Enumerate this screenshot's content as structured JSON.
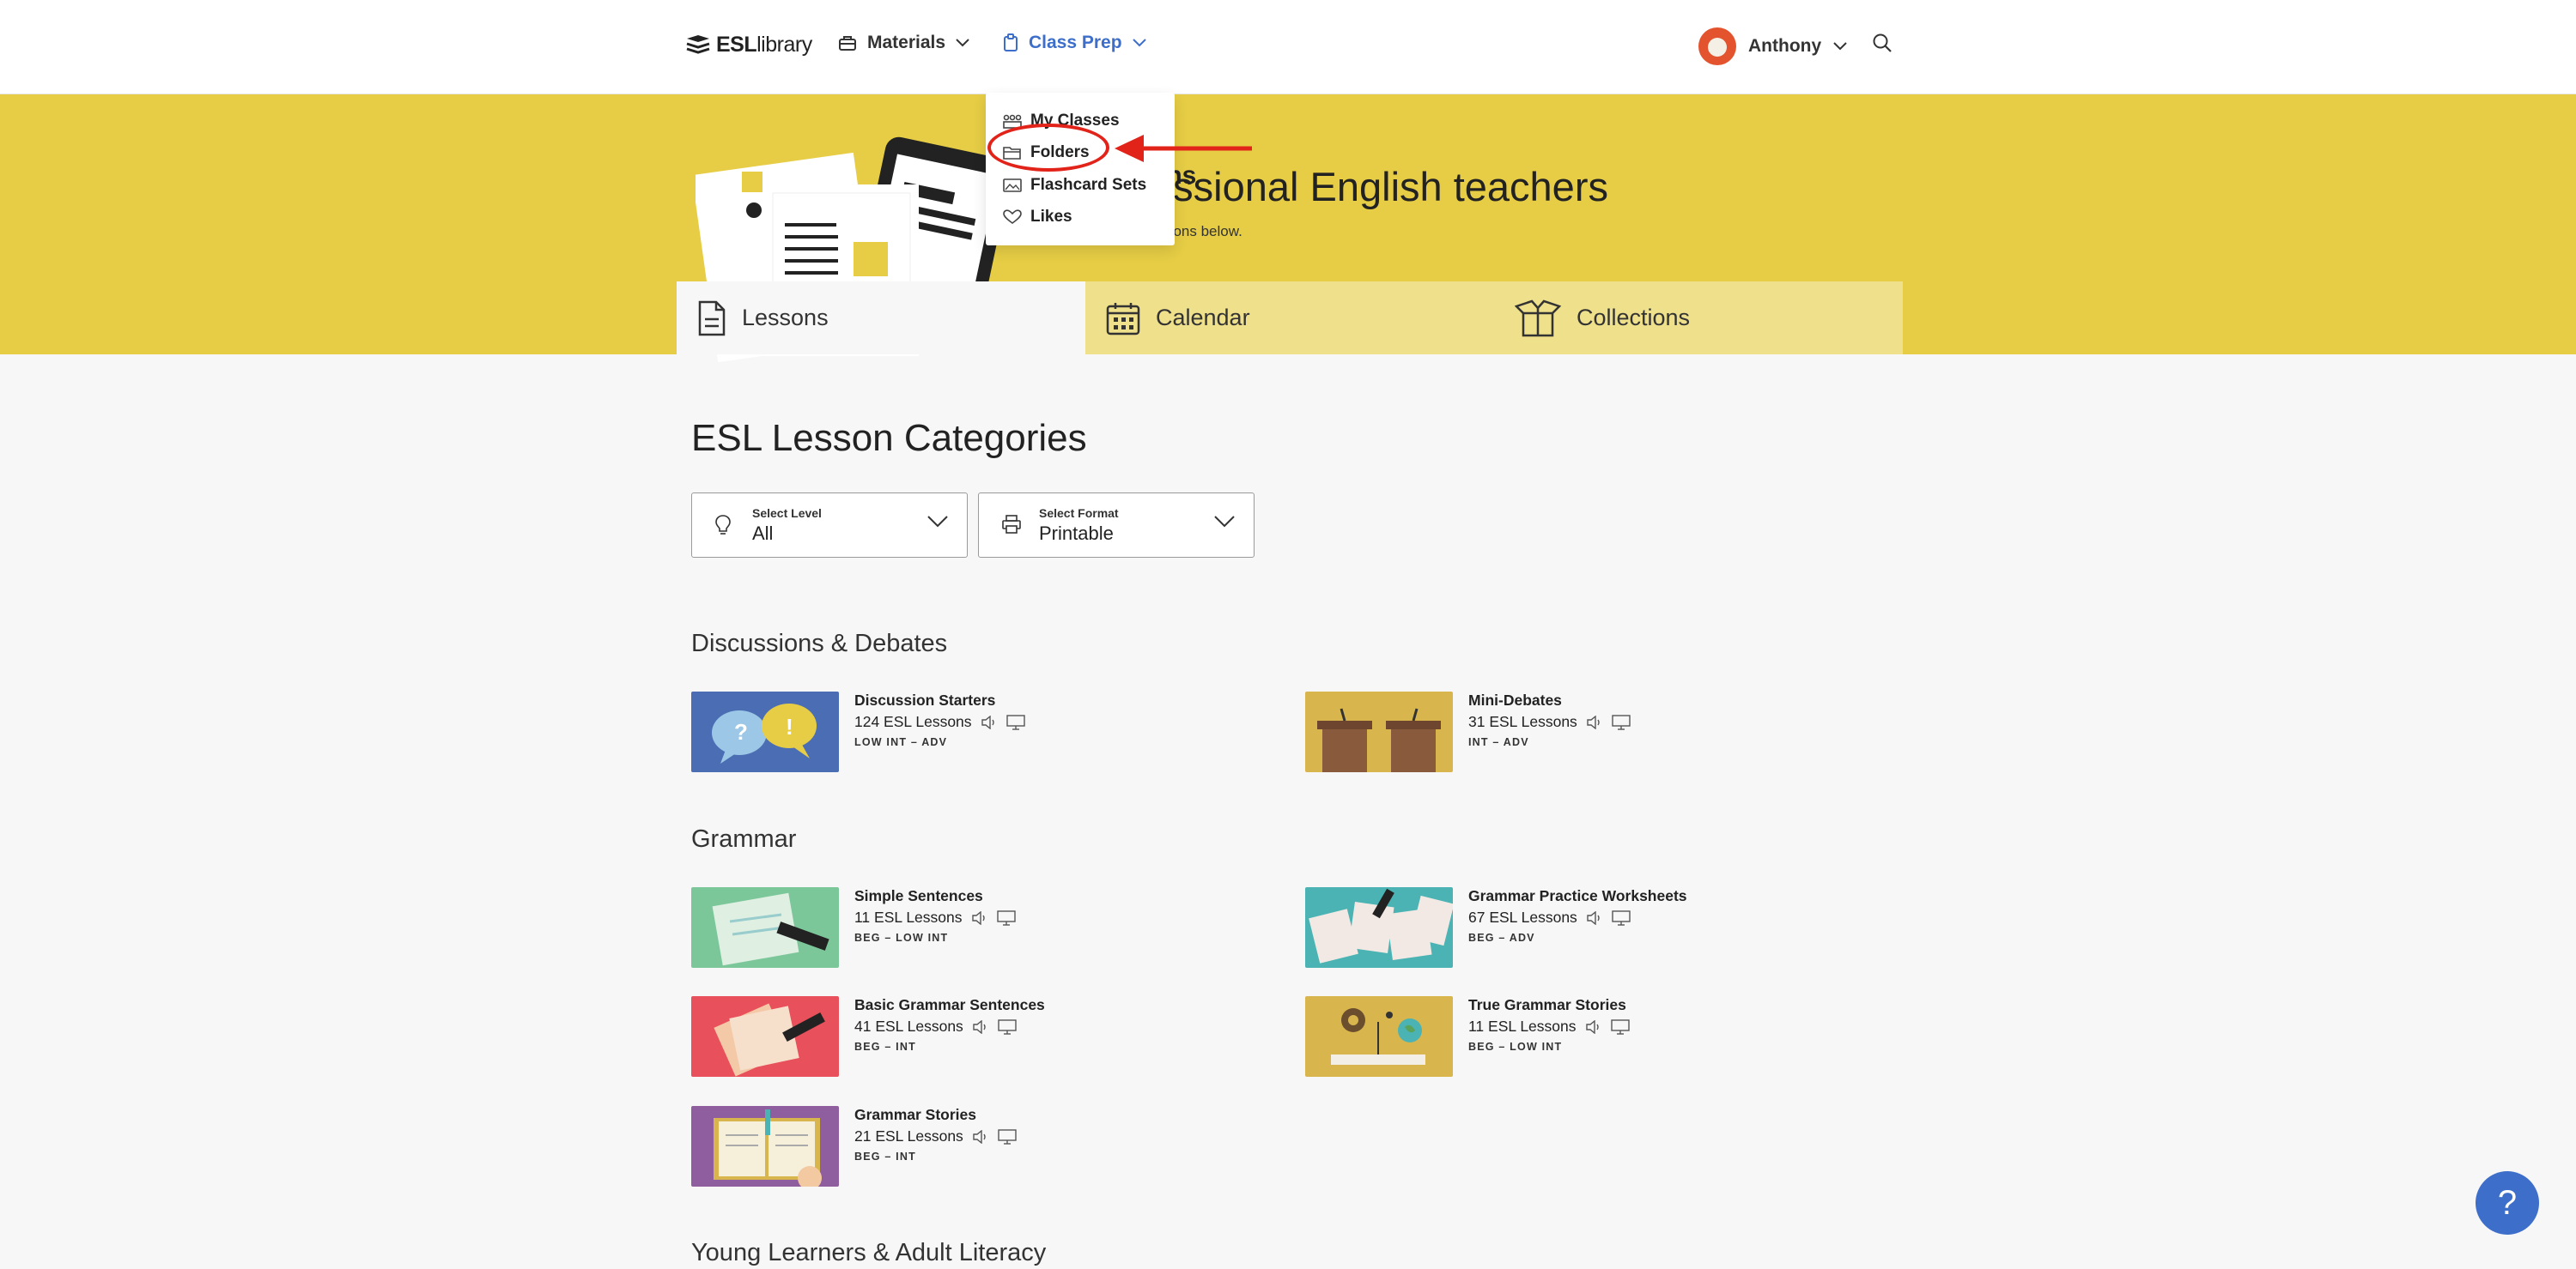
{
  "nav": {
    "logo_bold": "ESL",
    "logo_rest": "library",
    "materials_label": "Materials",
    "classprep_label": "Class Prep",
    "user_name": "Anthony",
    "accent_color": "#3d6ec9"
  },
  "dropdown": {
    "items": [
      {
        "label": "My Classes",
        "icon": "classes-icon"
      },
      {
        "label": "Folders",
        "icon": "folder-icon"
      },
      {
        "label": "Flashcard Sets",
        "icon": "flashcard-icon"
      },
      {
        "label": "Likes",
        "icon": "heart-icon"
      }
    ],
    "highlight_color": "#e2231a"
  },
  "banner": {
    "title_fragment": "ons",
    "subtitle_fragment": "essional English teachers",
    "hint_fragment": "ections below.",
    "color": "#e6cd45"
  },
  "tabs": [
    {
      "label": "Lessons",
      "icon": "document-icon"
    },
    {
      "label": "Calendar",
      "icon": "calendar-icon"
    },
    {
      "label": "Collections",
      "icon": "box-icon"
    }
  ],
  "page_title": "ESL Lesson Categories",
  "filters": {
    "level": {
      "label": "Select Level",
      "value": "All",
      "icon": "lightbulb-icon"
    },
    "format": {
      "label": "Select Format",
      "value": "Printable",
      "icon": "printer-icon"
    }
  },
  "sections": [
    {
      "title": "Discussions & Debates",
      "cards": [
        {
          "name": "Discussion Starters",
          "count": "124 ESL Lessons",
          "level": "LOW INT – ADV"
        },
        {
          "name": "Mini-Debates",
          "count": "31 ESL Lessons",
          "level": "INT – ADV"
        }
      ]
    },
    {
      "title": "Grammar",
      "cards": [
        {
          "name": "Simple Sentences",
          "count": "11 ESL Lessons",
          "level": "BEG – LOW INT"
        },
        {
          "name": "Grammar Practice Worksheets",
          "count": "67 ESL Lessons",
          "level": "BEG – ADV"
        },
        {
          "name": "Basic Grammar Sentences",
          "count": "41 ESL Lessons",
          "level": "BEG – INT"
        },
        {
          "name": "True Grammar Stories",
          "count": "11 ESL Lessons",
          "level": "BEG – LOW INT"
        },
        {
          "name": "Grammar Stories",
          "count": "21 ESL Lessons",
          "level": "BEG – INT"
        }
      ]
    },
    {
      "title": "Young Learners & Adult Literacy",
      "cards": []
    }
  ],
  "help_label": "?"
}
